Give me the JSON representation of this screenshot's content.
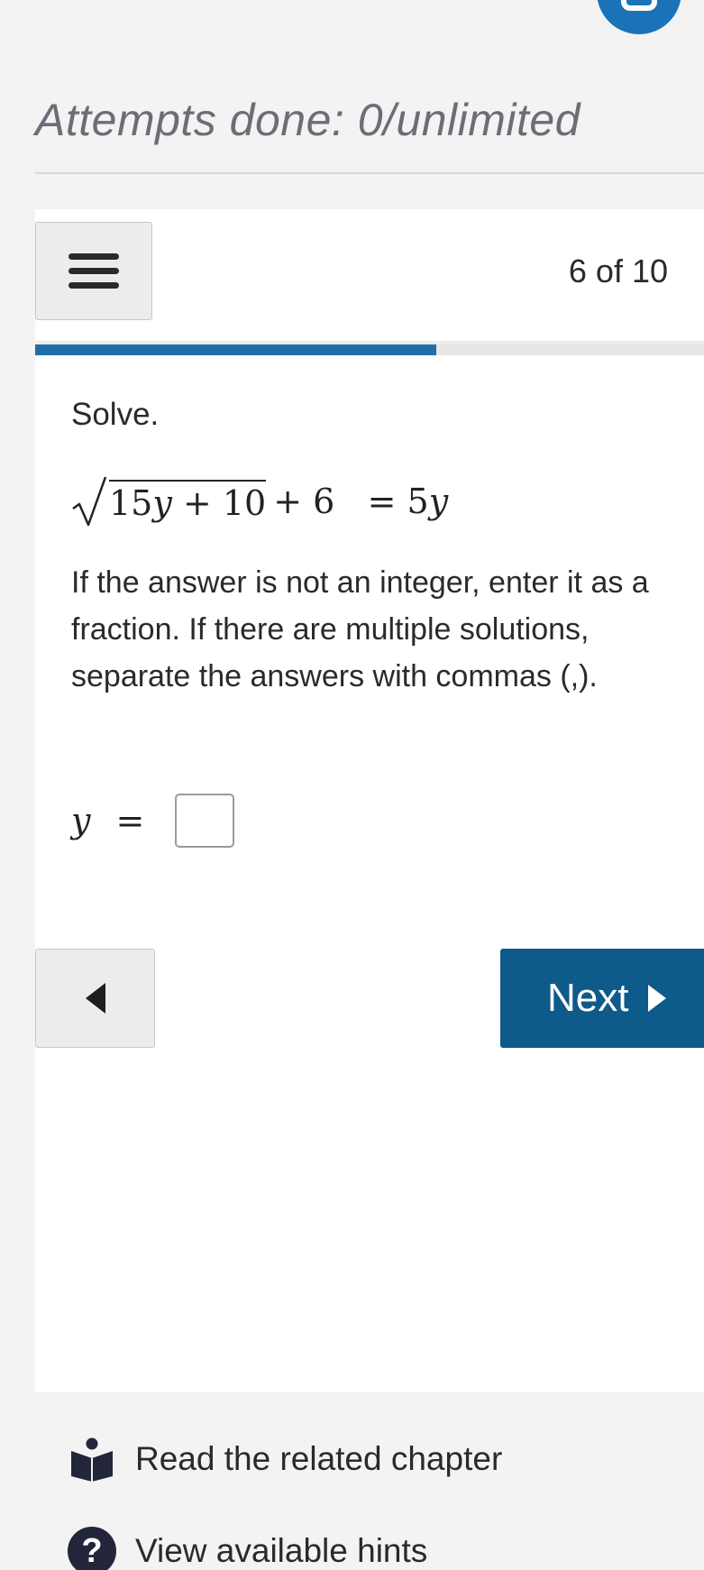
{
  "attempts": {
    "text": "Attempts done: 0/unlimited"
  },
  "nav": {
    "counter": "6 of 10",
    "progress_fraction": 0.6
  },
  "question": {
    "label": "Solve.",
    "equation": {
      "radicand_coef": "15",
      "radicand_var": "y",
      "radicand_op": "+",
      "radicand_const": "10",
      "outer_op": "+",
      "outer_const": "6",
      "equals": "=",
      "rhs_coef": "5",
      "rhs_var": "y"
    },
    "instructions": "If the answer is not an integer, enter it as a fraction. If there are multiple solutions, separate the answers with commas (,).",
    "answer": {
      "variable": "y",
      "equals": "=",
      "value": ""
    }
  },
  "buttons": {
    "next_label": "Next"
  },
  "links": {
    "chapter": "Read the related chapter",
    "hints": "View available hints",
    "hint_icon_glyph": "?"
  },
  "colors": {
    "primary": "#0e5a8a",
    "progress": "#1f6ea8",
    "fab": "#1a73b8"
  },
  "icons": {
    "fab": "chat-bubble-icon",
    "menu": "hamburger-menu-icon",
    "prev": "triangle-left-icon",
    "next": "triangle-right-icon",
    "chapter": "book-reader-icon",
    "hints": "question-circle-icon"
  }
}
